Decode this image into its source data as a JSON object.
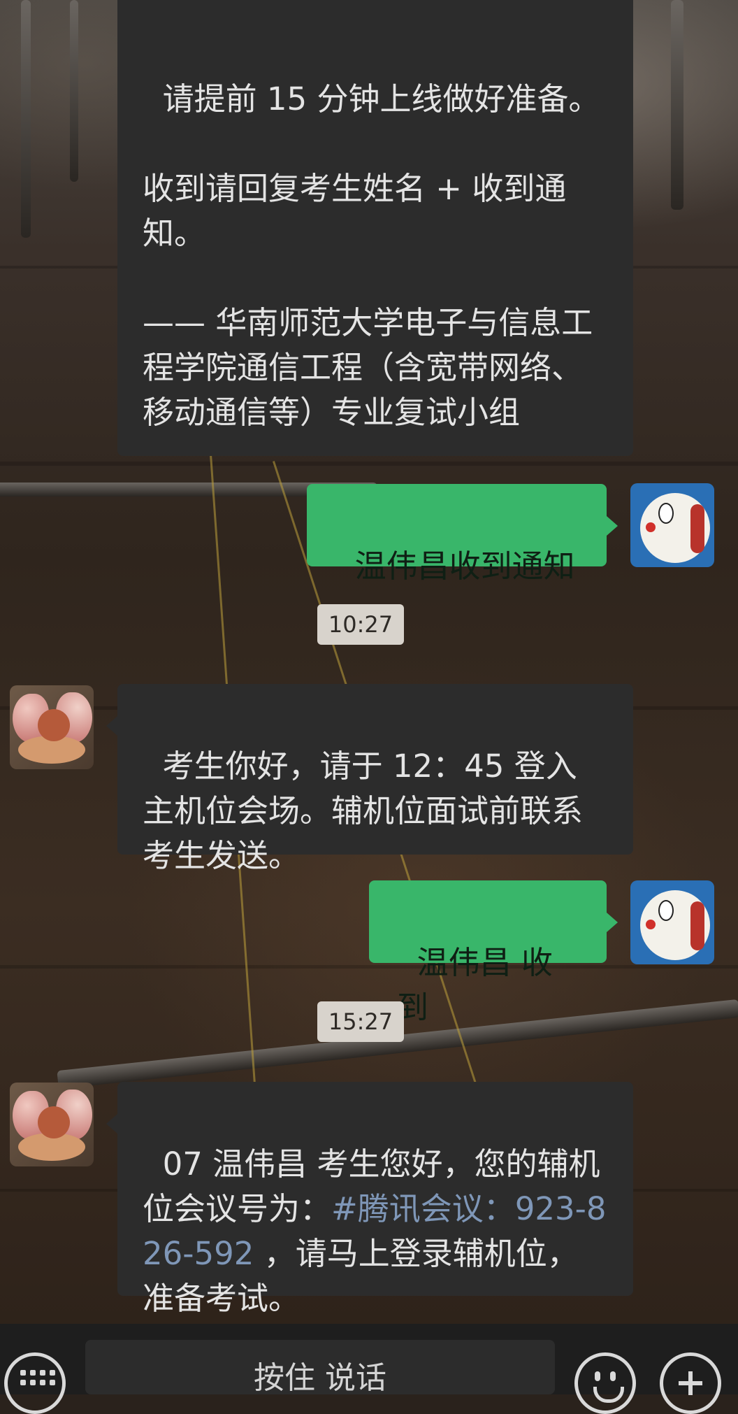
{
  "messages": [
    {
      "id": "m1",
      "direction": "incoming",
      "text": "请提前 15 分钟上线做好准备。\n\n收到请回复考生姓名 + 收到通知。\n\n—— 华南师范大学电子与信息工程学院通信工程（含宽带网络、移动通信等）专业复试小组"
    },
    {
      "id": "m2",
      "direction": "outgoing",
      "text": "温伟昌收到通知"
    },
    {
      "id": "t1",
      "type": "timestamp",
      "text": "10:27"
    },
    {
      "id": "m3",
      "direction": "incoming",
      "text": "考生你好，请于 12：45 登入主机位会场。辅机位面试前联系考生发送。"
    },
    {
      "id": "m4",
      "direction": "outgoing",
      "text": "温伟昌 收到"
    },
    {
      "id": "t2",
      "type": "timestamp",
      "text": "15:27"
    },
    {
      "id": "m5",
      "direction": "incoming",
      "text_before": "07 温伟昌 考生您好，您的辅机位会议号为：",
      "link_text": "#腾讯会议：923-826-592",
      "text_after": " ，请马上登录辅机位，准备考试。"
    }
  ],
  "input_bar": {
    "voice_button_label": "按住 说话",
    "left_icon": "keyboard-icon",
    "right_icons": [
      "emoji-icon",
      "plus-icon"
    ]
  },
  "avatars": {
    "self": "doraemon-avatar",
    "contact": "cherub-avatar"
  }
}
